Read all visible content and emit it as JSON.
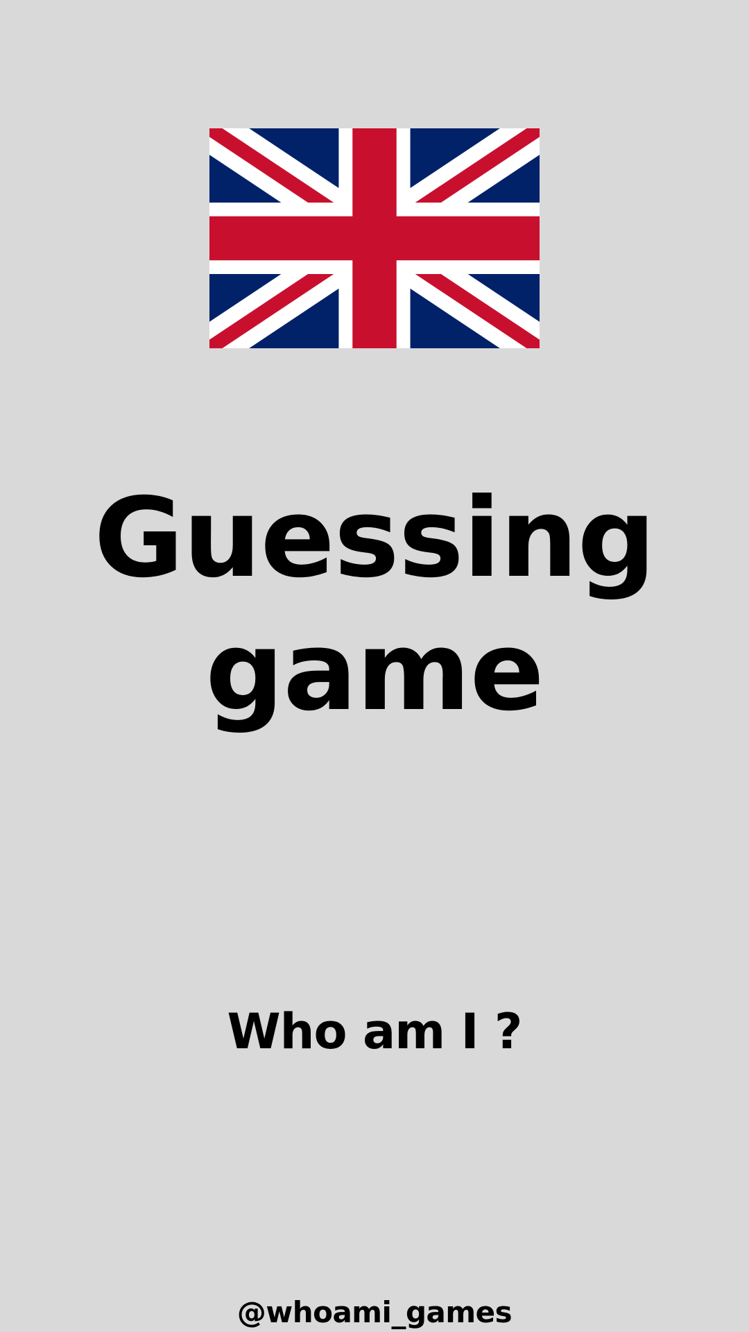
{
  "screen": {
    "background_color": "#d9d9d9",
    "text_color": "#000000"
  },
  "flag": {
    "icon": "union-jack-flag-icon",
    "colors": {
      "blue": "#012169",
      "white": "#FFFFFF",
      "red": "#C8102E"
    }
  },
  "title": {
    "line1": "Guessing",
    "line2": "game"
  },
  "subtitle": "Who am I ?",
  "handle": "@whoami_games"
}
